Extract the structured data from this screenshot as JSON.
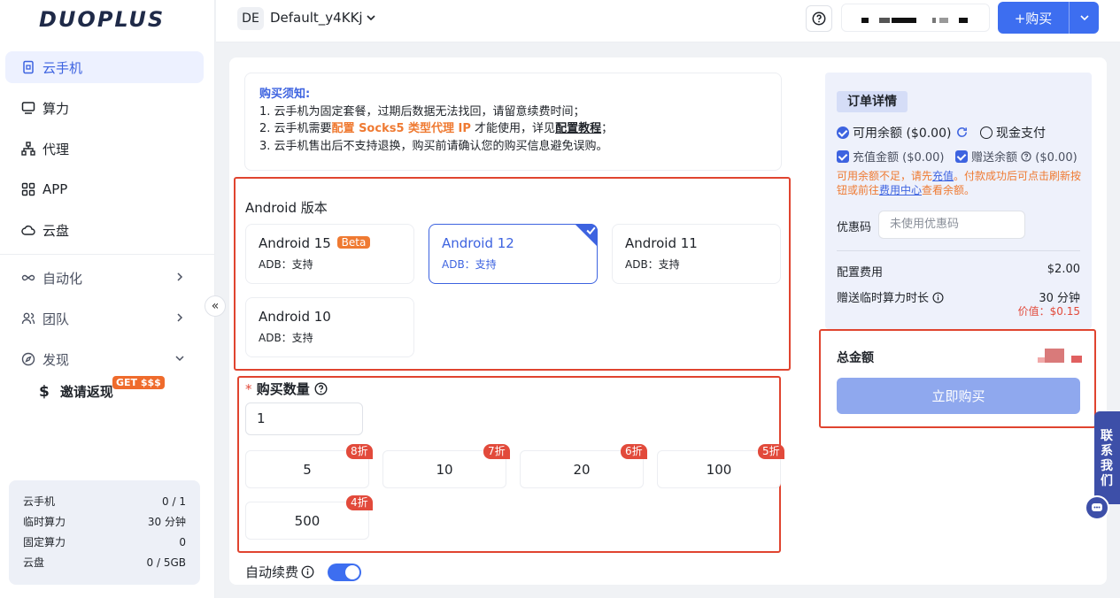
{
  "sidebar": {
    "logo": "DUOPLUS",
    "items": [
      {
        "label": "云手机"
      },
      {
        "label": "算力"
      },
      {
        "label": "代理"
      },
      {
        "label": "APP"
      },
      {
        "label": "云盘"
      },
      {
        "label": "自动化"
      },
      {
        "label": "团队"
      },
      {
        "label": "发现"
      }
    ],
    "invite": {
      "symbol": "$",
      "label": "邀请返现",
      "badge": "GET $$$"
    },
    "collapse": "«",
    "stats": [
      {
        "label": "云手机",
        "value": "0 / 1"
      },
      {
        "label": "临时算力",
        "value": "30 分钟"
      },
      {
        "label": "固定算力",
        "value": "0"
      },
      {
        "label": "云盘",
        "value": "0 / 5GB"
      }
    ]
  },
  "topbar": {
    "workspace_badge": "DE",
    "workspace_name": "Default_y4KKj",
    "buy_label": "+购买"
  },
  "notice": {
    "title": "购买须知:",
    "line1": "1. 云手机为固定套餐，过期后数据无法找回，请留意续费时间；",
    "line2_a": "2. 云手机需要",
    "line2_b": "配置 Socks5 类型代理 IP",
    "line2_c": " 才能使用，详见",
    "line2_d": "配置教程",
    "line2_e": "；",
    "line3": "3. 云手机售出后不支持退换，购买前请确认您的购买信息避免误购。"
  },
  "android": {
    "label": "Android 版本",
    "versions": [
      {
        "name": "Android 15",
        "badge": "Beta",
        "adb": "ADB：支持"
      },
      {
        "name": "Android 12",
        "adb": "ADB：支持"
      },
      {
        "name": "Android 11",
        "adb": "ADB：支持"
      },
      {
        "name": "Android 10",
        "adb": "ADB：支持"
      }
    ]
  },
  "quantity": {
    "required_mark": "*",
    "label": "购买数量",
    "value": "1",
    "options": [
      {
        "qty": "5",
        "discount": "8折"
      },
      {
        "qty": "10",
        "discount": "7折"
      },
      {
        "qty": "20",
        "discount": "6折"
      },
      {
        "qty": "100",
        "discount": "5折"
      },
      {
        "qty": "500",
        "discount": "4折"
      }
    ]
  },
  "auto_renew": {
    "label": "自动续费",
    "enabled": true
  },
  "order": {
    "title": "订单详情",
    "balance": "可用余额 ($0.00)",
    "cash": "现金支付",
    "recharge": "充值金额 ($0.00)",
    "gift": "赠送余额",
    "gift_amount": "($0.00)",
    "warn_a": "可用余额不足，请先",
    "warn_link1": "充值",
    "warn_b": "。付款成功后可点击刷新按钮或前往",
    "warn_link2": "费用中心",
    "warn_c": "查看余额。",
    "coupon_label": "优惠码",
    "coupon_placeholder": "未使用优惠码",
    "config_fee_label": "配置费用",
    "config_fee_value": "$2.00",
    "bonus_label": "赠送临时算力时长",
    "bonus_value": "30 分钟",
    "bonus_worth": "价值：$0.15",
    "total_label": "总金额",
    "buy_now": "立即购买"
  },
  "contact": "联系我们",
  "colors": {
    "accent": "#3d6ef0",
    "highlight": "#e0442f",
    "orange": "#ef7a32"
  }
}
